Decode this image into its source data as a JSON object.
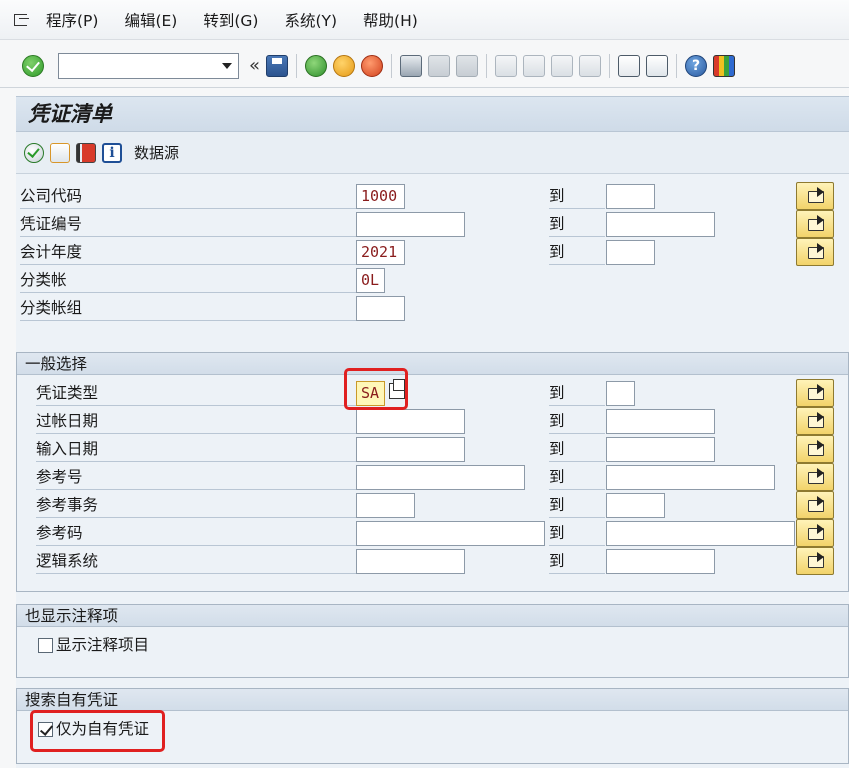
{
  "menu": {
    "items": [
      "程序(P)",
      "编辑(E)",
      "转到(G)",
      "系统(Y)",
      "帮助(H)"
    ]
  },
  "toolbar": {
    "command_value": "",
    "back_glyph": "«"
  },
  "screen": {
    "title": "凭证清单",
    "app_toolbar_text": "数据源",
    "to_label": "到"
  },
  "main_fields": {
    "company_code": {
      "label": "公司代码",
      "from": "1000",
      "to": ""
    },
    "document_number": {
      "label": "凭证编号",
      "from": "",
      "to": ""
    },
    "fiscal_year": {
      "label": "会计年度",
      "from": "2021",
      "to": ""
    },
    "ledger": {
      "label": "分类帐",
      "value": "0L"
    },
    "ledger_group": {
      "label": "分类帐组",
      "value": ""
    }
  },
  "general_selection": {
    "title": "一般选择",
    "doc_type": {
      "label": "凭证类型",
      "from": "SA",
      "to": ""
    },
    "posting_date": {
      "label": "过帐日期",
      "from": "",
      "to": ""
    },
    "entry_date": {
      "label": "输入日期",
      "from": "",
      "to": ""
    },
    "reference": {
      "label": "参考号",
      "from": "",
      "to": ""
    },
    "ref_transaction": {
      "label": "参考事务",
      "from": "",
      "to": ""
    },
    "ref_key": {
      "label": "参考码",
      "from": "",
      "to": ""
    },
    "logical_system": {
      "label": "逻辑系统",
      "from": "",
      "to": ""
    }
  },
  "noted_items": {
    "title": "也显示注释项",
    "checkbox_label": "显示注释项目",
    "checked": false
  },
  "own_docs": {
    "title": "搜索自有凭证",
    "checkbox_label": "仅为自有凭证",
    "checked": true
  },
  "colors": {
    "value_text": "#8a1c1c",
    "highlight": "#e02020",
    "title_bg": "#d6e0eb"
  }
}
